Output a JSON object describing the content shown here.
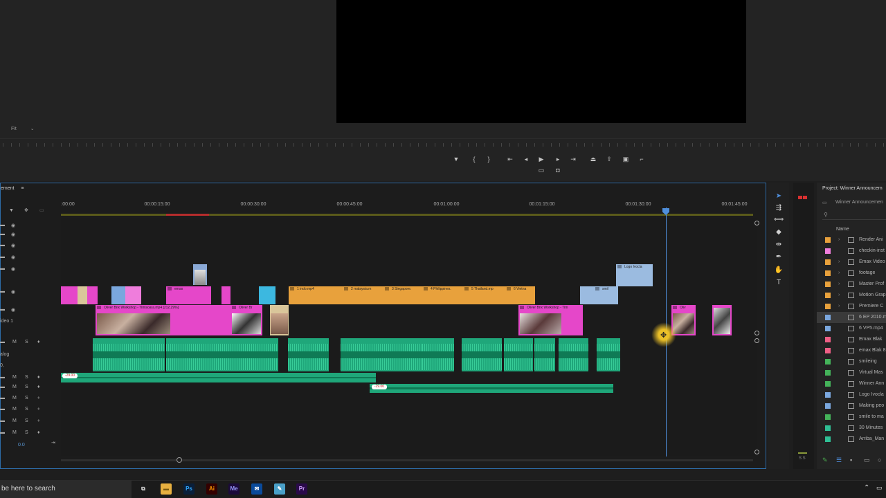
{
  "monitor": {
    "fit_label": "Fit",
    "transport": [
      "marker-icon",
      "mark-in-icon",
      "mark-out-icon",
      "go-to-in-icon",
      "step-back-icon",
      "play-icon",
      "step-forward-icon",
      "go-to-out-icon",
      "lift-icon",
      "extract-icon",
      "export-frame-icon",
      "button-editor-icon",
      "comparison-icon",
      "camera-icon"
    ]
  },
  "timeline": {
    "title": "ement",
    "timecodes": [
      {
        "label": ":00:00",
        "pos": 0
      },
      {
        "label": "00:00:15:00",
        "pos": 1
      },
      {
        "label": "00:00:30:00",
        "pos": 2
      },
      {
        "label": "00:00:45:00",
        "pos": 3
      },
      {
        "label": "00:01:00:00",
        "pos": 4
      },
      {
        "label": "00:01:15:00",
        "pos": 5
      },
      {
        "label": "00:01:30:00",
        "pos": 6
      },
      {
        "label": "00:01:45:00",
        "pos": 7
      }
    ],
    "video_track_label": "ideo 1",
    "audio_track_label": "alog",
    "volume_value": "0.0",
    "clip_labels": {
      "logo": "Logo Ivocla",
      "emax": "emax",
      "indo": "1 indo.mp4",
      "malaysia": "2 malaysia.m",
      "singapore": "3 Singapore.",
      "philippines": "4 Philippines.",
      "thailand": "5 Thailand.mp",
      "vietnam": "6 Vietna",
      "smil": "smil",
      "workshop1": "Oliver Brix Workshop - Timisoara.mp4 [212,29%]",
      "oliverbr": "Oliver Br",
      "workshop2": "Oliver Brix Workshop - Tim",
      "oliv": "Oliv",
      "a1_badge": "-29.00",
      "a2_badge": "-29.00"
    }
  },
  "project": {
    "title": "Project: Winner Announcem",
    "bin": "Winner Announcemen",
    "name_header": "Name",
    "items": [
      {
        "label": "Render Ani",
        "color": "#e8a13c",
        "type": "folder"
      },
      {
        "label": "checkin-inst",
        "color": "#ef7ddc",
        "type": "file"
      },
      {
        "label": "Emax Video",
        "color": "#e8a13c",
        "type": "folder"
      },
      {
        "label": "footage",
        "color": "#e8a13c",
        "type": "folder"
      },
      {
        "label": "Master Prof",
        "color": "#e8a13c",
        "type": "folder"
      },
      {
        "label": "Motion Grap",
        "color": "#e8a13c",
        "type": "folder"
      },
      {
        "label": "Premiere C",
        "color": "#e8a13c",
        "type": "folder"
      },
      {
        "label": "6 EP 2010.m",
        "color": "#7aa7de",
        "type": "clip"
      },
      {
        "label": "6 VP5.mp4",
        "color": "#7aa7de",
        "type": "clip"
      },
      {
        "label": "Emax Blak",
        "color": "#ef5f86",
        "type": "clip"
      },
      {
        "label": "emax Blak 8",
        "color": "#ef5f86",
        "type": "clip"
      },
      {
        "label": "smileing",
        "color": "#44b35a",
        "type": "clip"
      },
      {
        "label": "Virtual Mas",
        "color": "#44b35a",
        "type": "clip"
      },
      {
        "label": "Winner Ann",
        "color": "#44b35a",
        "type": "clip"
      },
      {
        "label": "Logo Ivocla",
        "color": "#7aa7de",
        "type": "clip"
      },
      {
        "label": "Making peo",
        "color": "#7aa7de",
        "type": "clip"
      },
      {
        "label": "smile to ma",
        "color": "#44b35a",
        "type": "clip"
      },
      {
        "label": "30 Minutes",
        "color": "#2fbf95",
        "type": "clip"
      },
      {
        "label": "Arriba_Man",
        "color": "#2fbf95",
        "type": "clip"
      }
    ]
  },
  "taskbar": {
    "search_text": "be here to search",
    "apps": [
      {
        "name": "task-view-icon",
        "glyph": "⧉",
        "bg": "#1b1b1b",
        "fg": "#ddd"
      },
      {
        "name": "file-explorer-icon",
        "glyph": "▬",
        "bg": "#e8b040",
        "fg": "#7a5a10"
      },
      {
        "name": "photoshop-icon",
        "glyph": "Ps",
        "bg": "#0a1f3a",
        "fg": "#31a8ff"
      },
      {
        "name": "illustrator-icon",
        "glyph": "Ai",
        "bg": "#330000",
        "fg": "#ff9a00"
      },
      {
        "name": "media-encoder-icon",
        "glyph": "Me",
        "bg": "#1b0a3a",
        "fg": "#9a9aff"
      },
      {
        "name": "outlook-icon",
        "glyph": "✉",
        "bg": "#0a4a9a",
        "fg": "#ffffff"
      },
      {
        "name": "notepad-icon",
        "glyph": "✎",
        "bg": "#4aa0c8",
        "fg": "#ffffff"
      },
      {
        "name": "premiere-icon",
        "glyph": "Pr",
        "bg": "#2a0a4a",
        "fg": "#d1a3ff"
      }
    ]
  }
}
